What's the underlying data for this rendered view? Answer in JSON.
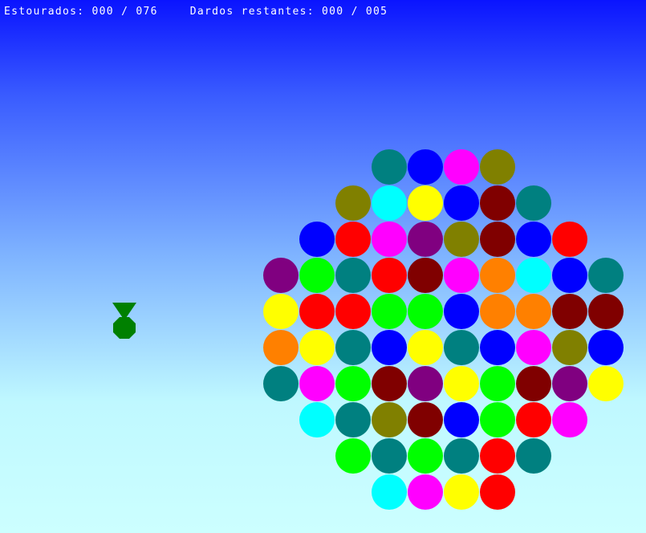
{
  "hud": {
    "popped_label": "Estourados:",
    "popped_count": "000",
    "popped_total": "076",
    "darts_label": "Dardos restantes:",
    "darts_count": "000",
    "darts_total": "005",
    "separator": "/"
  },
  "colors": {
    "teal": "#008080",
    "blue": "#0000ff",
    "magenta": "#ff00ff",
    "olive": "#808000",
    "cyan": "#00ffff",
    "yellow": "#ffff00",
    "maroon": "#800000",
    "red": "#ff0000",
    "purple": "#800080",
    "green": "#00ff00",
    "orange": "#ff8000",
    "player": "#008000"
  },
  "balloons": [
    [
      "teal",
      "blue",
      "magenta",
      "olive"
    ],
    [
      "olive",
      "cyan",
      "yellow",
      "blue",
      "maroon",
      "teal"
    ],
    [
      "blue",
      "red",
      "magenta",
      "purple",
      "olive",
      "maroon",
      "blue",
      "red"
    ],
    [
      "purple",
      "green",
      "teal",
      "red",
      "maroon",
      "magenta",
      "orange",
      "cyan",
      "blue",
      "teal"
    ],
    [
      "yellow",
      "red",
      "red",
      "green",
      "green",
      "blue",
      "orange",
      "orange",
      "maroon",
      "maroon"
    ],
    [
      "orange",
      "yellow",
      "teal",
      "blue",
      "yellow",
      "teal",
      "blue",
      "magenta",
      "olive",
      "blue"
    ],
    [
      "teal",
      "magenta",
      "green",
      "maroon",
      "purple",
      "yellow",
      "green",
      "maroon",
      "purple",
      "yellow"
    ],
    [
      "cyan",
      "teal",
      "olive",
      "maroon",
      "blue",
      "green",
      "red",
      "magenta"
    ],
    [
      "green",
      "teal",
      "green",
      "teal",
      "red",
      "teal"
    ],
    [
      "cyan",
      "magenta",
      "yellow",
      "red"
    ]
  ],
  "player": {
    "icon": "dart-launcher-icon"
  }
}
